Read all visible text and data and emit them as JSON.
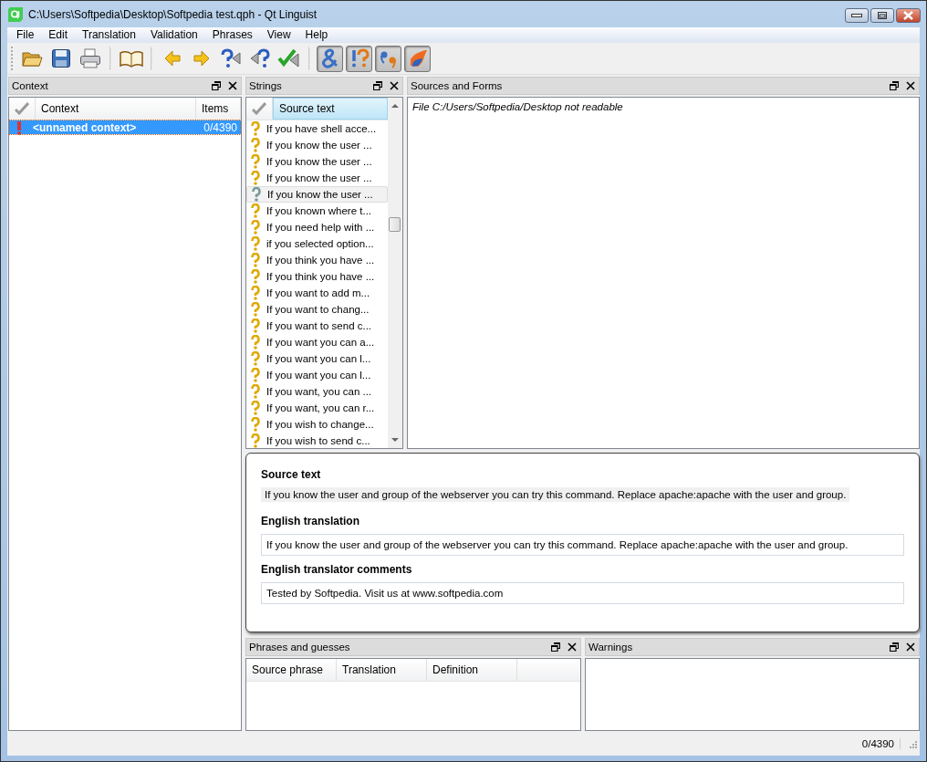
{
  "window": {
    "title": "C:\\Users\\Softpedia\\Desktop\\Softpedia test.qph - Qt Linguist"
  },
  "menu": [
    "File",
    "Edit",
    "Translation",
    "Validation",
    "Phrases",
    "View",
    "Help"
  ],
  "toolbar": [
    {
      "kind": "open"
    },
    {
      "kind": "save"
    },
    {
      "kind": "print"
    },
    {
      "kind": "sep"
    },
    {
      "kind": "book"
    },
    {
      "kind": "sep"
    },
    {
      "kind": "prev"
    },
    {
      "kind": "next"
    },
    {
      "kind": "prev-unfinished"
    },
    {
      "kind": "next-unfinished"
    },
    {
      "kind": "done-next"
    },
    {
      "kind": "sep"
    },
    {
      "kind": "accelerators",
      "checked": true
    },
    {
      "kind": "punctuation",
      "checked": true
    },
    {
      "kind": "phrases",
      "checked": true
    },
    {
      "kind": "placemarkers",
      "checked": true
    }
  ],
  "context_dock": {
    "title": "Context",
    "columns": [
      "Context",
      "Items"
    ],
    "rows": [
      {
        "name": "<unnamed context>",
        "items": "0/4390",
        "selected": true
      }
    ]
  },
  "strings_dock": {
    "title": "Strings",
    "column": "Source text",
    "rows": [
      {
        "text": "If you have shell acce...",
        "selected": false
      },
      {
        "text": "If you know the user ...",
        "selected": false
      },
      {
        "text": "If you know the user ...",
        "selected": false
      },
      {
        "text": "If you know the user ...",
        "selected": false
      },
      {
        "text": "If you know the user ...",
        "selected": true
      },
      {
        "text": "If you known where t...",
        "selected": false
      },
      {
        "text": "If you need help with ...",
        "selected": false
      },
      {
        "text": "if you selected option...",
        "selected": false
      },
      {
        "text": "If you think you have ...",
        "selected": false
      },
      {
        "text": "If you think you have ...",
        "selected": false
      },
      {
        "text": "If you want to add m...",
        "selected": false
      },
      {
        "text": "If you want to chang...",
        "selected": false
      },
      {
        "text": "If you want to send c...",
        "selected": false
      },
      {
        "text": "If you want you can a...",
        "selected": false
      },
      {
        "text": "If you want you can l...",
        "selected": false
      },
      {
        "text": "If you want you can l...",
        "selected": false
      },
      {
        "text": "If you want, you can ...",
        "selected": false
      },
      {
        "text": "If you want, you can r...",
        "selected": false
      },
      {
        "text": "If you wish to change...",
        "selected": false
      },
      {
        "text": "If you wish to send c...",
        "selected": false
      }
    ]
  },
  "sources_dock": {
    "title": "Sources and Forms",
    "message": "File C:/Users/Softpedia/Desktop not readable"
  },
  "editor": {
    "source_label": "Source text",
    "source": "If you know the user and group of the webserver you can try this command. Replace apache:apache with the user and group.",
    "translation_label": "English translation",
    "translation": "If you know the user and group of the webserver you can try this command. Replace apache:apache with the user and group.",
    "comment_label": "English translator comments",
    "comment": "Tested by Softpedia. Visit us at www.softpedia.com"
  },
  "phrases_dock": {
    "title": "Phrases and guesses",
    "columns": [
      "Source phrase",
      "Translation",
      "Definition"
    ]
  },
  "warnings_dock": {
    "title": "Warnings"
  },
  "status": "0/4390"
}
